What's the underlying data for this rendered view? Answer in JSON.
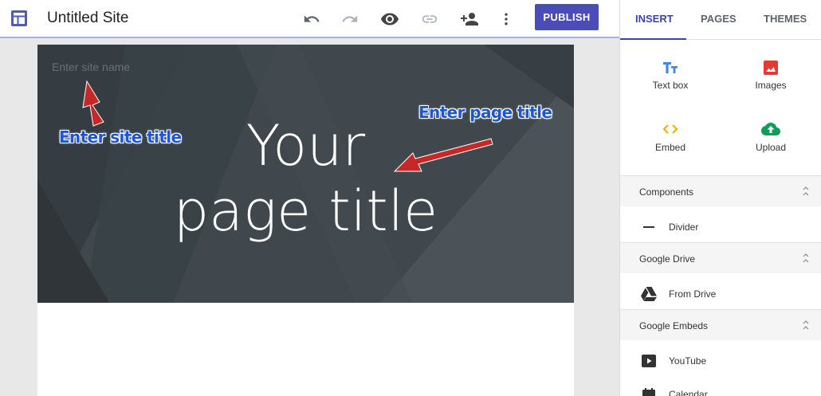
{
  "topbar": {
    "site_title": "Untitled Site",
    "publish_label": "PUBLISH",
    "icons": [
      "undo-icon",
      "redo-icon",
      "preview-icon",
      "link-icon",
      "share-icon",
      "more-icon"
    ]
  },
  "canvas": {
    "site_name_placeholder": "Enter site name",
    "page_title_line1": "Your",
    "page_title_line2": "page title",
    "annotation_site": "Enter site title",
    "annotation_page": "Enter page title"
  },
  "panel": {
    "tabs": [
      {
        "label": "INSERT",
        "active": true
      },
      {
        "label": "PAGES",
        "active": false
      },
      {
        "label": "THEMES",
        "active": false
      }
    ],
    "insert_items": [
      {
        "label": "Text box",
        "icon": "text-box-icon",
        "color": "#4285f4"
      },
      {
        "label": "Images",
        "icon": "image-icon",
        "color": "#e53935"
      },
      {
        "label": "Embed",
        "icon": "embed-icon",
        "color": "#f4b400"
      },
      {
        "label": "Upload",
        "icon": "upload-icon",
        "color": "#0f9d58"
      }
    ],
    "sections": [
      {
        "title": "Components",
        "items": [
          {
            "label": "Divider",
            "icon": "divider-icon"
          }
        ]
      },
      {
        "title": "Google Drive",
        "items": [
          {
            "label": "From Drive",
            "icon": "drive-icon"
          }
        ]
      },
      {
        "title": "Google Embeds",
        "items": [
          {
            "label": "YouTube",
            "icon": "youtube-icon"
          },
          {
            "label": "Calendar",
            "icon": "calendar-icon"
          }
        ]
      }
    ]
  },
  "colors": {
    "accent": "#4a4db8",
    "header_bg": "#3f474c",
    "annotation_text": "#1e55d4",
    "annotation_arrow": "#c62828"
  }
}
